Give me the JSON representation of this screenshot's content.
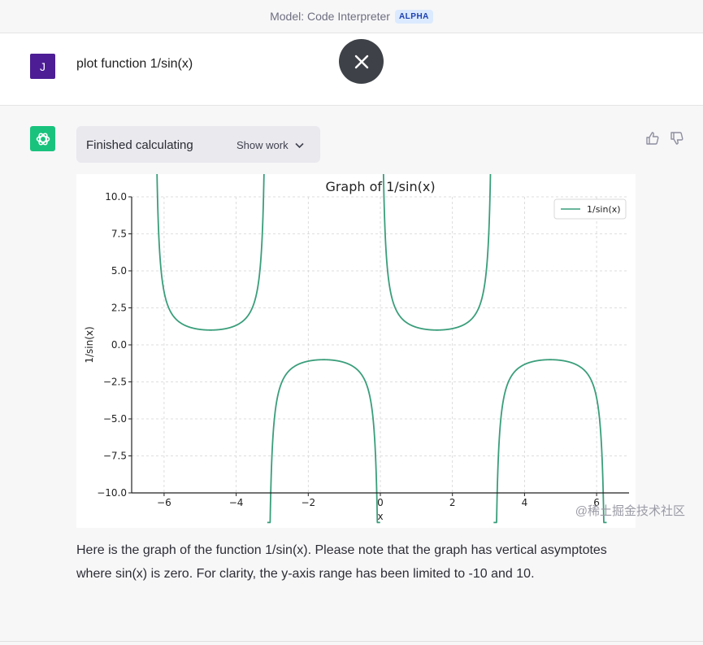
{
  "header": {
    "model_label": "Model: Code Interpreter",
    "badge": "ALPHA"
  },
  "user_message": {
    "avatar_initial": "J",
    "text": "plot function 1/sin(x)"
  },
  "overlay": {
    "icon": "close-icon"
  },
  "assistant": {
    "avatar_icon": "openai-logo-icon",
    "status": "Finished calculating",
    "show_work_label": "Show work",
    "feedback_icons": [
      "thumbs-up-icon",
      "thumbs-down-icon"
    ],
    "response_text": "Here is the graph of the function 1/sin(x). Please note that the graph has vertical asymptotes where sin(x) is zero. For clarity, the y-axis range has been limited to -10 and 10."
  },
  "watermark": "@稀土掘金技术社区",
  "chart_data": {
    "type": "line",
    "title": "Graph of 1/sin(x)",
    "xlabel": "x",
    "ylabel": "1/sin(x)",
    "xlim": [
      -6.9,
      6.9
    ],
    "ylim": [
      -10,
      10
    ],
    "x_ticks": [
      -6,
      -4,
      -2,
      0,
      2,
      4,
      6
    ],
    "x_tick_labels": [
      "−6",
      "−4",
      "−2",
      "0",
      "2",
      "4",
      "6"
    ],
    "y_ticks": [
      10,
      7.5,
      5,
      2.5,
      0,
      -2.5,
      -5,
      -7.5,
      -10
    ],
    "y_tick_labels": [
      "10.0",
      "7.5",
      "5.0",
      "2.5",
      "0.0",
      "−2.5",
      "−5.0",
      "−7.5",
      "−10.0"
    ],
    "x_domain": [
      -6.2832,
      6.2832
    ],
    "grid": true,
    "legend_position": "top-right",
    "series": [
      {
        "name": "1/sin(x)",
        "function": "1/sin(x)",
        "color": "#3a9e7b"
      }
    ]
  }
}
